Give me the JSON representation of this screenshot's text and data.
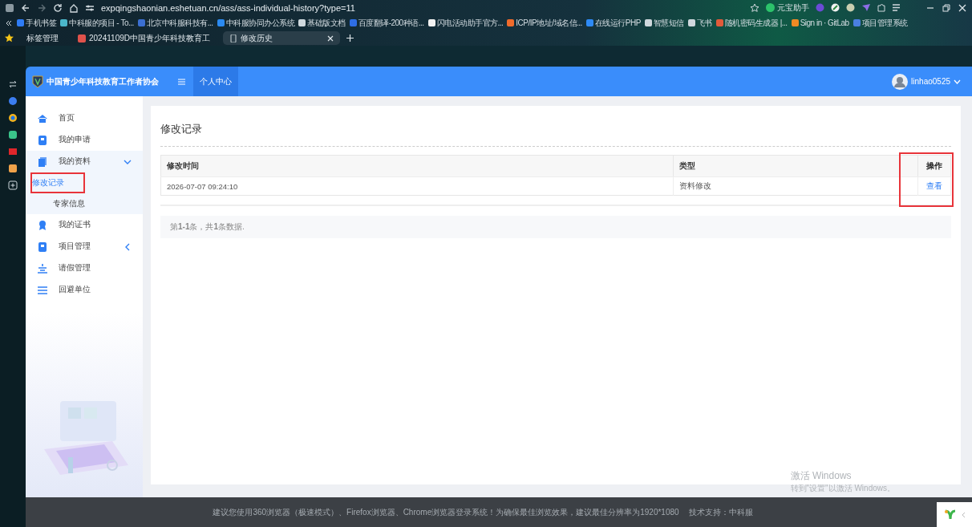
{
  "browser": {
    "url": "expqingshaonian.eshetuan.cn/ass/ass-individual-history?type=11",
    "assistant": "元宝助手",
    "bookmarks": [
      "手机书签",
      "中科服的项目 - To...",
      "北京中科服科技有...",
      "中科服协同办公系统",
      "基础版文档",
      "百度翻译-200种语...",
      "闪电活动助手官方...",
      "ICP/IP地址/域名信...",
      "在线运行PHP",
      "智慧短信",
      "飞书",
      "随机密码生成器 |...",
      "Sign in · GitLab",
      "项目管理系统"
    ],
    "tab_group": "标签管理",
    "tabs": [
      {
        "label": "20241109D中国青少年科技教育工",
        "selected": false
      },
      {
        "label": "修改历史",
        "selected": true
      }
    ]
  },
  "header": {
    "logo_text": "中国青少年科技教育工作者协会",
    "nav_tab": "个人中心",
    "user": "linhao0525"
  },
  "sidebar": {
    "items": [
      {
        "label": "首页",
        "selected": false
      },
      {
        "label": "我的申请",
        "selected": false
      },
      {
        "label": "我的资料",
        "selected": false,
        "expanded": true,
        "children": [
          {
            "label": "修改记录",
            "selected": true,
            "highlighted": true
          },
          {
            "label": "专家信息",
            "selected": false,
            "highlighted": false
          }
        ]
      },
      {
        "label": "我的证书",
        "selected": false
      },
      {
        "label": "项目管理",
        "selected": false,
        "expanded": false
      },
      {
        "label": "请假管理",
        "selected": false
      },
      {
        "label": "回避单位",
        "selected": false
      }
    ]
  },
  "content": {
    "title": "修改记录",
    "table": {
      "columns": [
        {
          "label": "修改时间",
          "highlighted": false
        },
        {
          "label": "类型",
          "highlighted": false
        },
        {
          "label": "操作",
          "highlighted": true
        }
      ],
      "rows": [
        {
          "cells": [
            "2026-07-07 09:24:10",
            "资料修改"
          ],
          "action": "查看"
        }
      ]
    },
    "summary": "第**1-1**条，共**1**条数据."
  },
  "footer": {
    "notice": "建议您使用360浏览器（极速模式）、Firefox浏览器、Chrome浏览器登录系统！为确保最佳浏览效果，建议最佳分辨率为1920*1080",
    "support": "技术支持：中科服"
  },
  "os_overlay": {
    "line_1": "激活 Windows",
    "line_2": "转到\"设置\"以激活 Windows。"
  }
}
